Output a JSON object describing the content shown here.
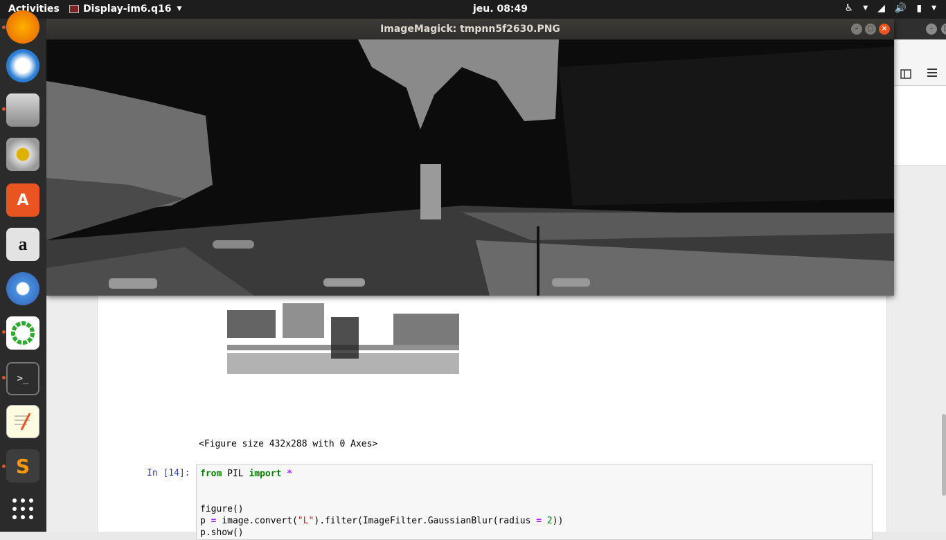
{
  "topbar": {
    "activities": "Activities",
    "app_name": "Display-im6.q16",
    "clock": "jeu. 08:49",
    "tray_icons": [
      "accessibility-icon",
      "network-icon",
      "volume-icon",
      "battery-icon",
      "power-menu-icon"
    ]
  },
  "dock": {
    "items": [
      "firefox-icon",
      "thunderbird-icon",
      "files-icon",
      "rhythmbox-icon",
      "software-center-icon",
      "amazon-icon",
      "chromium-icon",
      "app-green-ring-icon",
      "terminal-icon",
      "text-editor-icon",
      "sublime-text-icon",
      "show-applications-icon"
    ]
  },
  "imagemagick": {
    "title": "ImageMagick: tmpnn5f2630.PNG"
  },
  "notebook": {
    "output_text": "<Figure size 432x288 with 0 Axes>",
    "prompt": "In [14]:",
    "code_line1_kw1": "from",
    "code_line1_mod": " PIL ",
    "code_line1_kw2": "import",
    "code_line1_star": " *",
    "code_line2": "figure()",
    "code_line3_a": "p ",
    "code_line3_eq": "=",
    "code_line3_b": " image.convert(",
    "code_line3_str": "\"L\"",
    "code_line3_c": ").filter(ImageFilter.GaussianBlur(radius ",
    "code_line3_eq2": "=",
    "code_line3_num": " 2",
    "code_line3_d": "))",
    "code_line4": "p.show()"
  }
}
